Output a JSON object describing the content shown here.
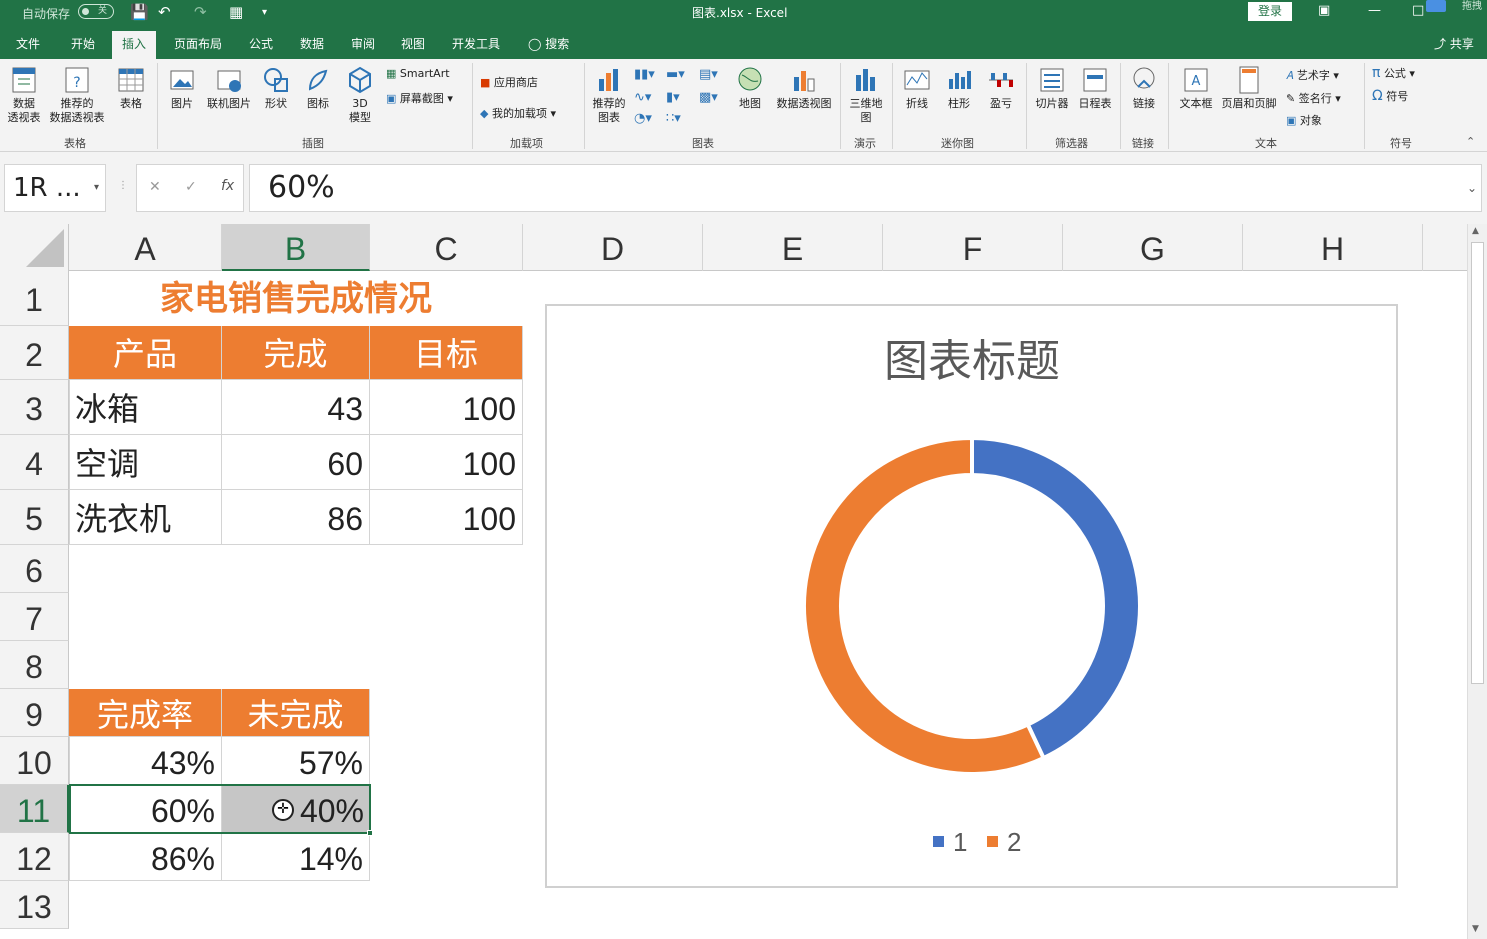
{
  "titlebar": {
    "autosave": "自动保存",
    "toggle": "关",
    "filename": "图表.xlsx",
    "separator": "-",
    "app": "Excel",
    "login": "登录",
    "share_hint": "拖拽"
  },
  "tabs": [
    "文件",
    "开始",
    "插入",
    "页面布局",
    "公式",
    "数据",
    "审阅",
    "视图",
    "开发工具",
    "搜索"
  ],
  "share": "共享",
  "ribbon": {
    "pivot": "数据\n透视表",
    "recpivot": "推荐的\n数据透视表",
    "table": "表格",
    "picture": "图片",
    "onlinepic": "联机图片",
    "shapes": "形状",
    "icons": "图标",
    "model3d": "3D\n模型",
    "smartart": "SmartArt",
    "screenshot": "屏幕截图",
    "store": "应用商店",
    "myaddins": "我的加载项",
    "reccharts": "推荐的\n图表",
    "maps": "地图",
    "pivotchart": "数据透视图",
    "map3d": "三维地\n图",
    "line": "折线",
    "column": "柱形",
    "winloss": "盈亏",
    "slicer": "切片器",
    "timeline": "日程表",
    "link": "链接",
    "textbox": "文本框",
    "headerfooter": "页眉和页脚",
    "wordart": "艺术字",
    "signature": "签名行",
    "object": "对象",
    "equation": "公式",
    "symbol": "符号",
    "groups": {
      "tables": "表格",
      "illustrations": "插图",
      "addins": "加载项",
      "charts": "图表",
      "tours": "演示",
      "sparklines": "迷你图",
      "filters": "筛选器",
      "links": "链接",
      "text": "文本",
      "symbols": "符号"
    }
  },
  "formula": {
    "namebox": "1R ...",
    "value": "60%"
  },
  "columns": [
    "A",
    "B",
    "C",
    "D",
    "E",
    "F",
    "G",
    "H"
  ],
  "rows": [
    "1",
    "2",
    "3",
    "4",
    "5",
    "6",
    "7",
    "8",
    "9",
    "10",
    "11",
    "12",
    "13"
  ],
  "sheet": {
    "title": "家电销售完成情况",
    "header": [
      "产品",
      "完成",
      "目标"
    ],
    "data": [
      [
        "冰箱",
        "43",
        "100"
      ],
      [
        "空调",
        "60",
        "100"
      ],
      [
        "洗衣机",
        "86",
        "100"
      ]
    ],
    "rate_header": [
      "完成率",
      "未完成"
    ],
    "rates": [
      [
        "43%",
        "57%"
      ],
      [
        "60%",
        "40%"
      ],
      [
        "86%",
        "14%"
      ]
    ]
  },
  "chart_data": {
    "type": "pie",
    "subtype": "doughnut",
    "title": "图表标题",
    "categories": [
      "1",
      "2"
    ],
    "values": [
      43,
      57
    ],
    "colors": [
      "#4472c4",
      "#ed7d31"
    ],
    "legend": "bottom"
  }
}
